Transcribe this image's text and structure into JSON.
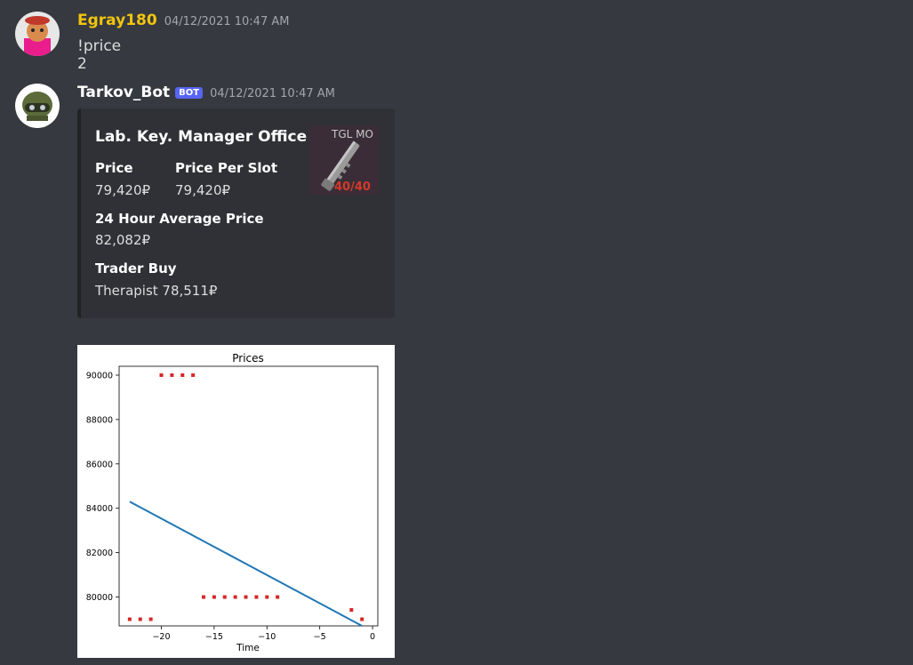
{
  "messages": [
    {
      "username": "Egray180",
      "username_color": "#f1c40f",
      "timestamp": "04/12/2021 10:47 AM",
      "content": "!price 2"
    },
    {
      "username": "Tarkov_Bot",
      "username_color": "#ffffff",
      "bot_tag": "BOT",
      "timestamp": "04/12/2021 10:47 AM"
    }
  ],
  "embed": {
    "title": "Lab. Key. Manager Office",
    "fields": [
      {
        "name": "Price",
        "value": "79,420₽"
      },
      {
        "name": "Price Per Slot",
        "value": "79,420₽"
      },
      {
        "name": "24 Hour Average Price",
        "value": "82,082₽"
      },
      {
        "name": "Trader Buy",
        "value": "Therapist 78,511₽"
      }
    ],
    "thumbnail": {
      "label": "TGL MO",
      "count": "40/40"
    }
  },
  "chart_data": {
    "type": "scatter",
    "title": "Prices",
    "xlabel": "Time",
    "ylabel": "",
    "xlim": [
      -24,
      0.5
    ],
    "ylim": [
      78700,
      90400
    ],
    "xticks": [
      -20,
      -15,
      -10,
      -5,
      0
    ],
    "xtick_labels": [
      "−20",
      "−15",
      "−10",
      "−5",
      "0"
    ],
    "yticks": [
      80000,
      82000,
      84000,
      86000,
      88000,
      90000
    ],
    "ytick_labels": [
      "80000",
      "82000",
      "84000",
      "86000",
      "88000",
      "90000"
    ],
    "series": [
      {
        "kind": "scatter",
        "color": "#d62728",
        "points": [
          [
            -23,
            79000
          ],
          [
            -22,
            79000
          ],
          [
            -21,
            79000
          ],
          [
            -20,
            90000
          ],
          [
            -19,
            90000
          ],
          [
            -18,
            90000
          ],
          [
            -17,
            90000
          ],
          [
            -16,
            80000
          ],
          [
            -15,
            80000
          ],
          [
            -14,
            80000
          ],
          [
            -13,
            80000
          ],
          [
            -12,
            80000
          ],
          [
            -11,
            80000
          ],
          [
            -10,
            80000
          ],
          [
            -9,
            80000
          ],
          [
            -2,
            79420
          ],
          [
            -1,
            79000
          ]
        ]
      },
      {
        "kind": "line",
        "color": "#1f77b4",
        "points": [
          [
            -23,
            84300
          ],
          [
            -1,
            78700
          ]
        ]
      }
    ]
  }
}
